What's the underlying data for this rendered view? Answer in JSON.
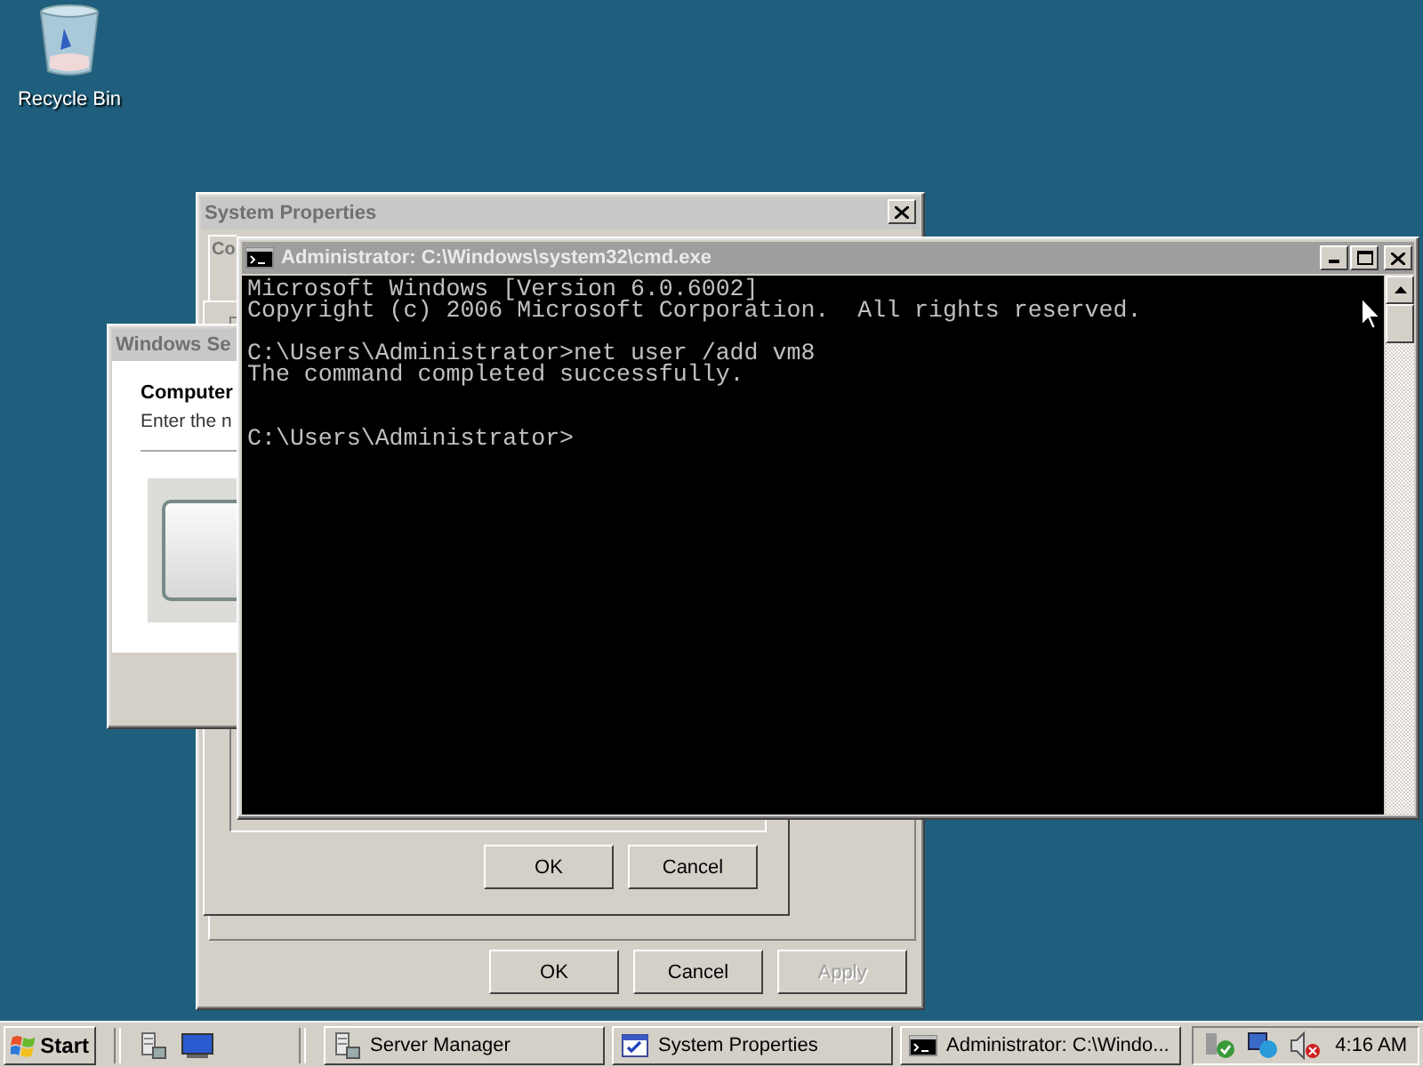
{
  "desktop_icons": [
    {
      "label": "Recycle Bin"
    }
  ],
  "system_properties": {
    "title": "System Properties",
    "tab": "Co",
    "inner_buttons": [
      {
        "label": "OK",
        "disabled": false
      },
      {
        "label": "Cancel",
        "disabled": false
      }
    ],
    "buttons": [
      {
        "label": "OK",
        "disabled": false
      },
      {
        "label": "Cancel",
        "disabled": false
      },
      {
        "label": "Apply",
        "disabled": true
      }
    ]
  },
  "windows_security": {
    "title": "Windows Se",
    "heading": "Computer",
    "text": "Enter the n"
  },
  "console_window": {
    "title": "Administrator: C:\\Windows\\system32\\cmd.exe",
    "text": "Microsoft Windows [Version 6.0.6002]\nCopyright (c) 2006 Microsoft Corporation.  All rights reserved.\n\nC:\\Users\\Administrator>net user /add vm8\nThe command completed successfully.\n\n\nC:\\Users\\Administrator>"
  },
  "taskbar": {
    "start": "Start",
    "tasks": [
      {
        "label": "Server Manager"
      },
      {
        "label": "System Properties"
      },
      {
        "label": "Administrator: C:\\Windo..."
      }
    ],
    "clock": "4:16 AM"
  }
}
